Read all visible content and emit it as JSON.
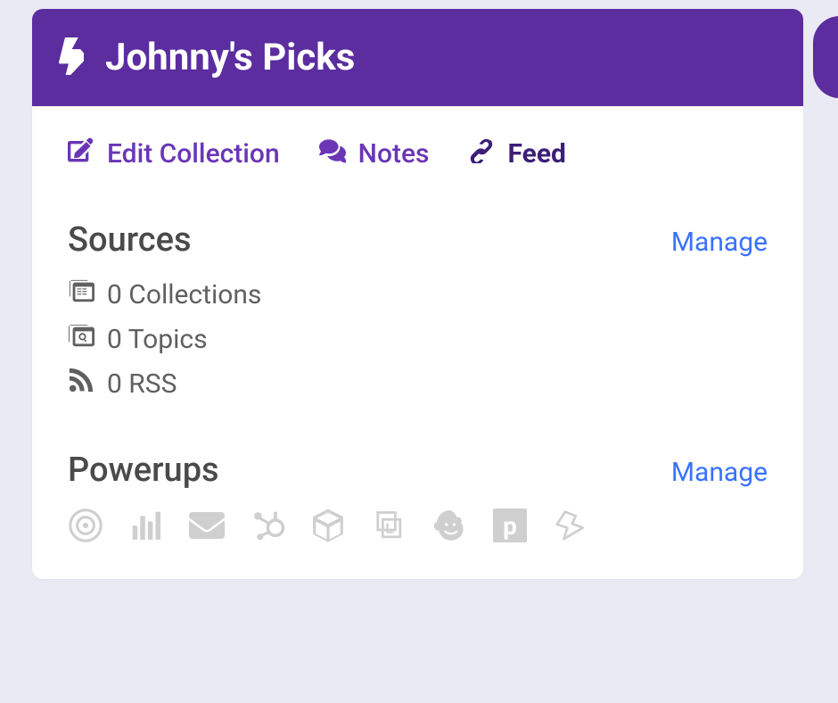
{
  "header": {
    "title": "Johnny's Picks",
    "icon": "lightning-icon"
  },
  "tabs": {
    "edit": {
      "label": "Edit Collection",
      "icon": "edit-icon"
    },
    "notes": {
      "label": "Notes",
      "icon": "comments-icon"
    },
    "feed": {
      "label": "Feed",
      "icon": "link-icon",
      "active": true
    }
  },
  "sources": {
    "title": "Sources",
    "manage_label": "Manage",
    "items": [
      {
        "icon": "collections-icon",
        "label": "0 Collections"
      },
      {
        "icon": "topics-icon",
        "label": "0 Topics"
      },
      {
        "icon": "rss-icon",
        "label": "0 RSS"
      }
    ]
  },
  "powerups": {
    "title": "Powerups",
    "manage_label": "Manage",
    "icons": [
      "target-icon",
      "bars-icon",
      "envelope-icon",
      "hubspot-icon",
      "cube-icon",
      "buffer-icon",
      "mailchimp-icon",
      "p-square-icon",
      "stripe-icon"
    ]
  },
  "colors": {
    "brand": "#5b2d9f",
    "link": "#3a72ff",
    "text": "#4a4a4a",
    "muted": "#cfcfcf"
  }
}
